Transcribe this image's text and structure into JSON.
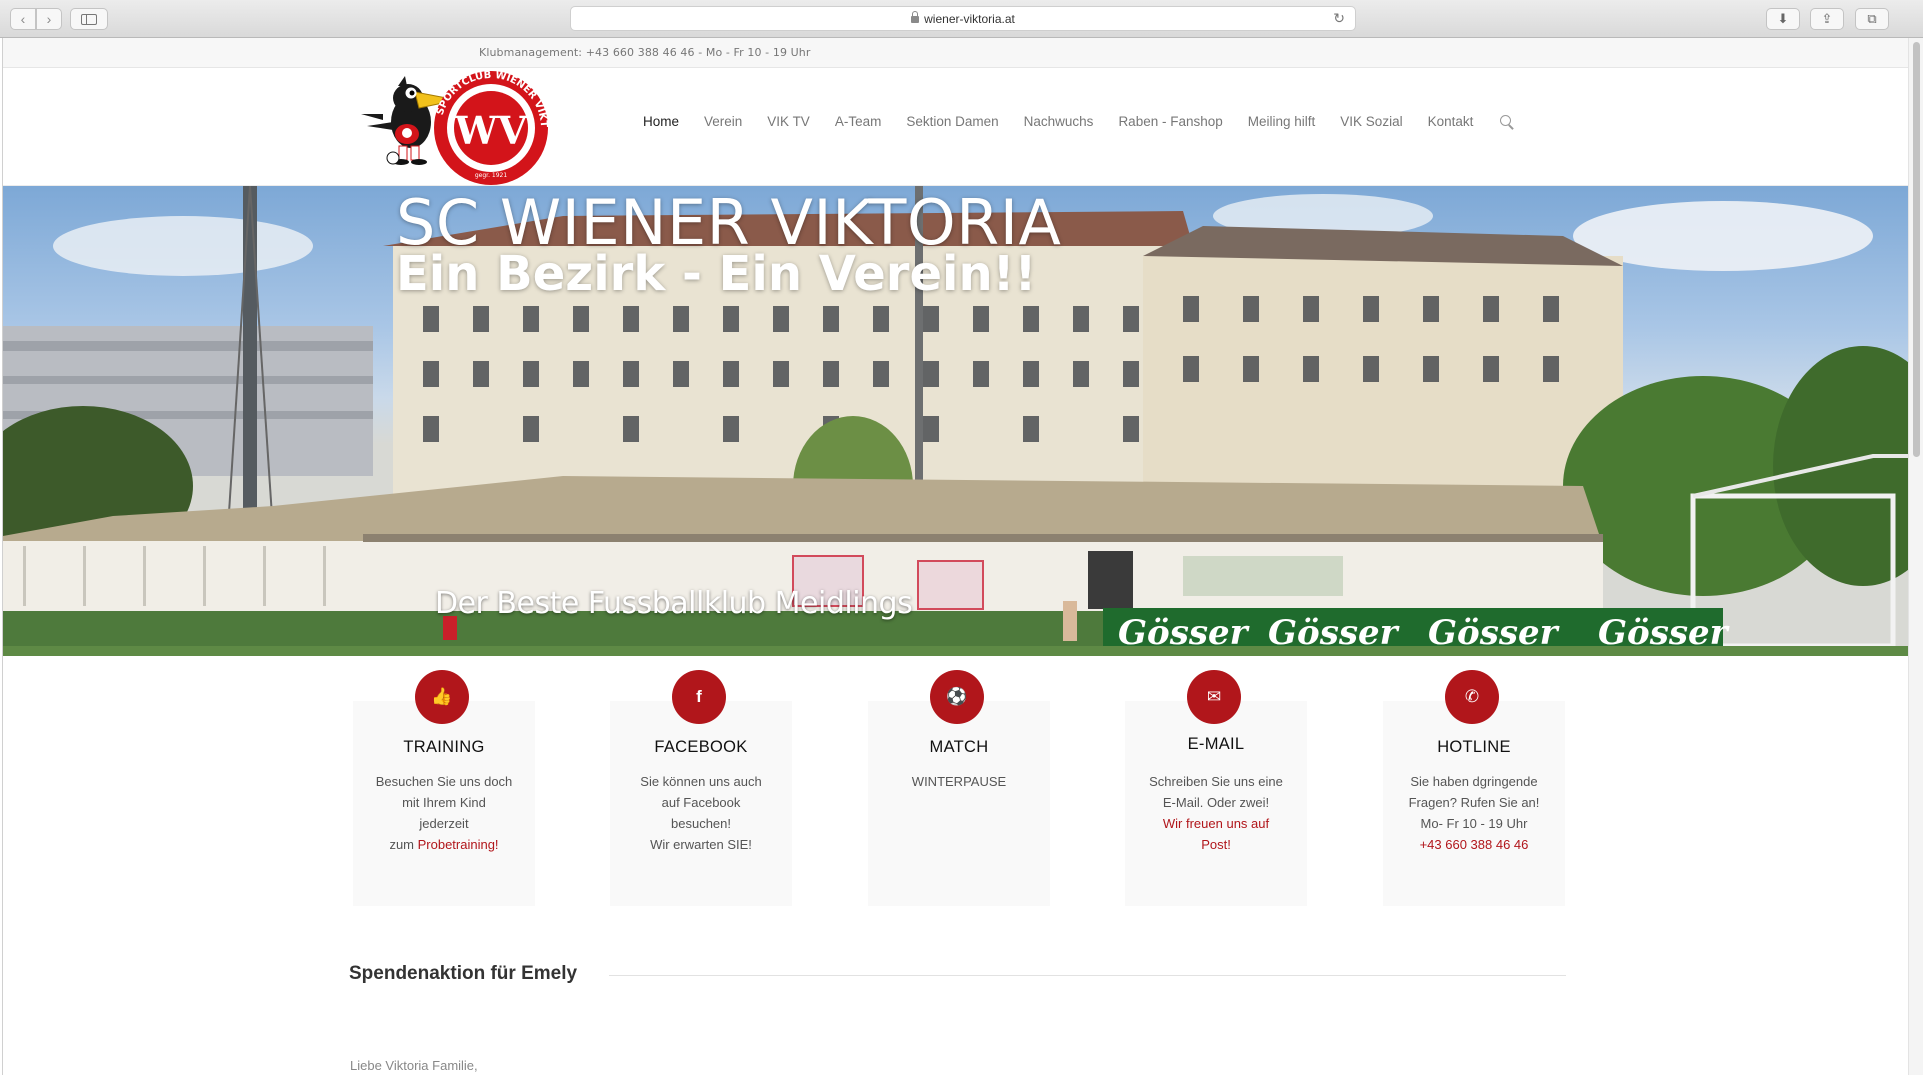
{
  "browser": {
    "url": "wiener-viktoria.at",
    "back_icon": "chevron-left-icon",
    "forward_icon": "chevron-right-icon",
    "back_glyph": "‹",
    "forward_glyph": "›",
    "reload_glyph": "↻",
    "download_glyph": "⬇",
    "share_glyph": "⇪",
    "tabs_glyph": "⧉",
    "newtab_glyph": "+"
  },
  "topbar": {
    "info": "Klubmanagement: +43 660 388 46 46 - Mo - Fr 10 - 19 Uhr"
  },
  "logo": {
    "ring_text": "SPORTCLUB WIENER VIKTORIA",
    "initials": "WV",
    "founded": "gegr. 1921"
  },
  "nav": {
    "items": [
      {
        "label": "Home",
        "active": true
      },
      {
        "label": "Verein"
      },
      {
        "label": "VIK TV"
      },
      {
        "label": "A-Team"
      },
      {
        "label": "Sektion Damen"
      },
      {
        "label": "Nachwuchs"
      },
      {
        "label": "Raben - Fanshop"
      },
      {
        "label": "Meiling hilft"
      },
      {
        "label": "VIK Sozial"
      },
      {
        "label": "Kontakt"
      }
    ]
  },
  "hero": {
    "title": "SC WIENER VIKTORIA",
    "subtitle": "Ein Bezirk - Ein Verein!!",
    "tagline": "Der Beste Fussballklub Meidlings",
    "banner_text": "Gösser"
  },
  "features": [
    {
      "title": "TRAINING",
      "icon": "thumbs-up-icon",
      "glyph": "👍",
      "lines": [
        "Besuchen Sie uns doch",
        "mit Ihrem Kind",
        "jederzeit",
        "zum "
      ],
      "link": "Probetraining!"
    },
    {
      "title": "FACEBOOK",
      "icon": "facebook-icon",
      "glyph": "f",
      "lines": [
        "Sie können uns auch",
        "auf Facebook",
        "besuchen!",
        "Wir erwarten SIE!"
      ],
      "link": ""
    },
    {
      "title": "MATCH",
      "icon": "soccer-ball-icon",
      "glyph": "⚽",
      "lines": [
        "WINTERPAUSE"
      ],
      "link": ""
    },
    {
      "title": "E-MAIL",
      "icon": "envelope-icon",
      "glyph": "✉",
      "lines": [
        "Schreiben Sie uns eine",
        "E-Mail. Oder zwei!"
      ],
      "link_lines": [
        "Wir freuen uns auf",
        "Post!"
      ]
    },
    {
      "title": "HOTLINE",
      "icon": "phone-icon",
      "glyph": "✆",
      "lines": [
        "Sie haben dgringende",
        "Fragen? Rufen Sie an!",
        "Mo- Fr 10 - 19 Uhr"
      ],
      "link": "+43 660 388 46 46"
    }
  ],
  "section": {
    "title": "Spendenaktion für Emely",
    "intro": "Liebe Viktoria Familie,"
  },
  "colors": {
    "accent": "#b1161b",
    "nav_active": "#222222",
    "nav": "#777777"
  }
}
